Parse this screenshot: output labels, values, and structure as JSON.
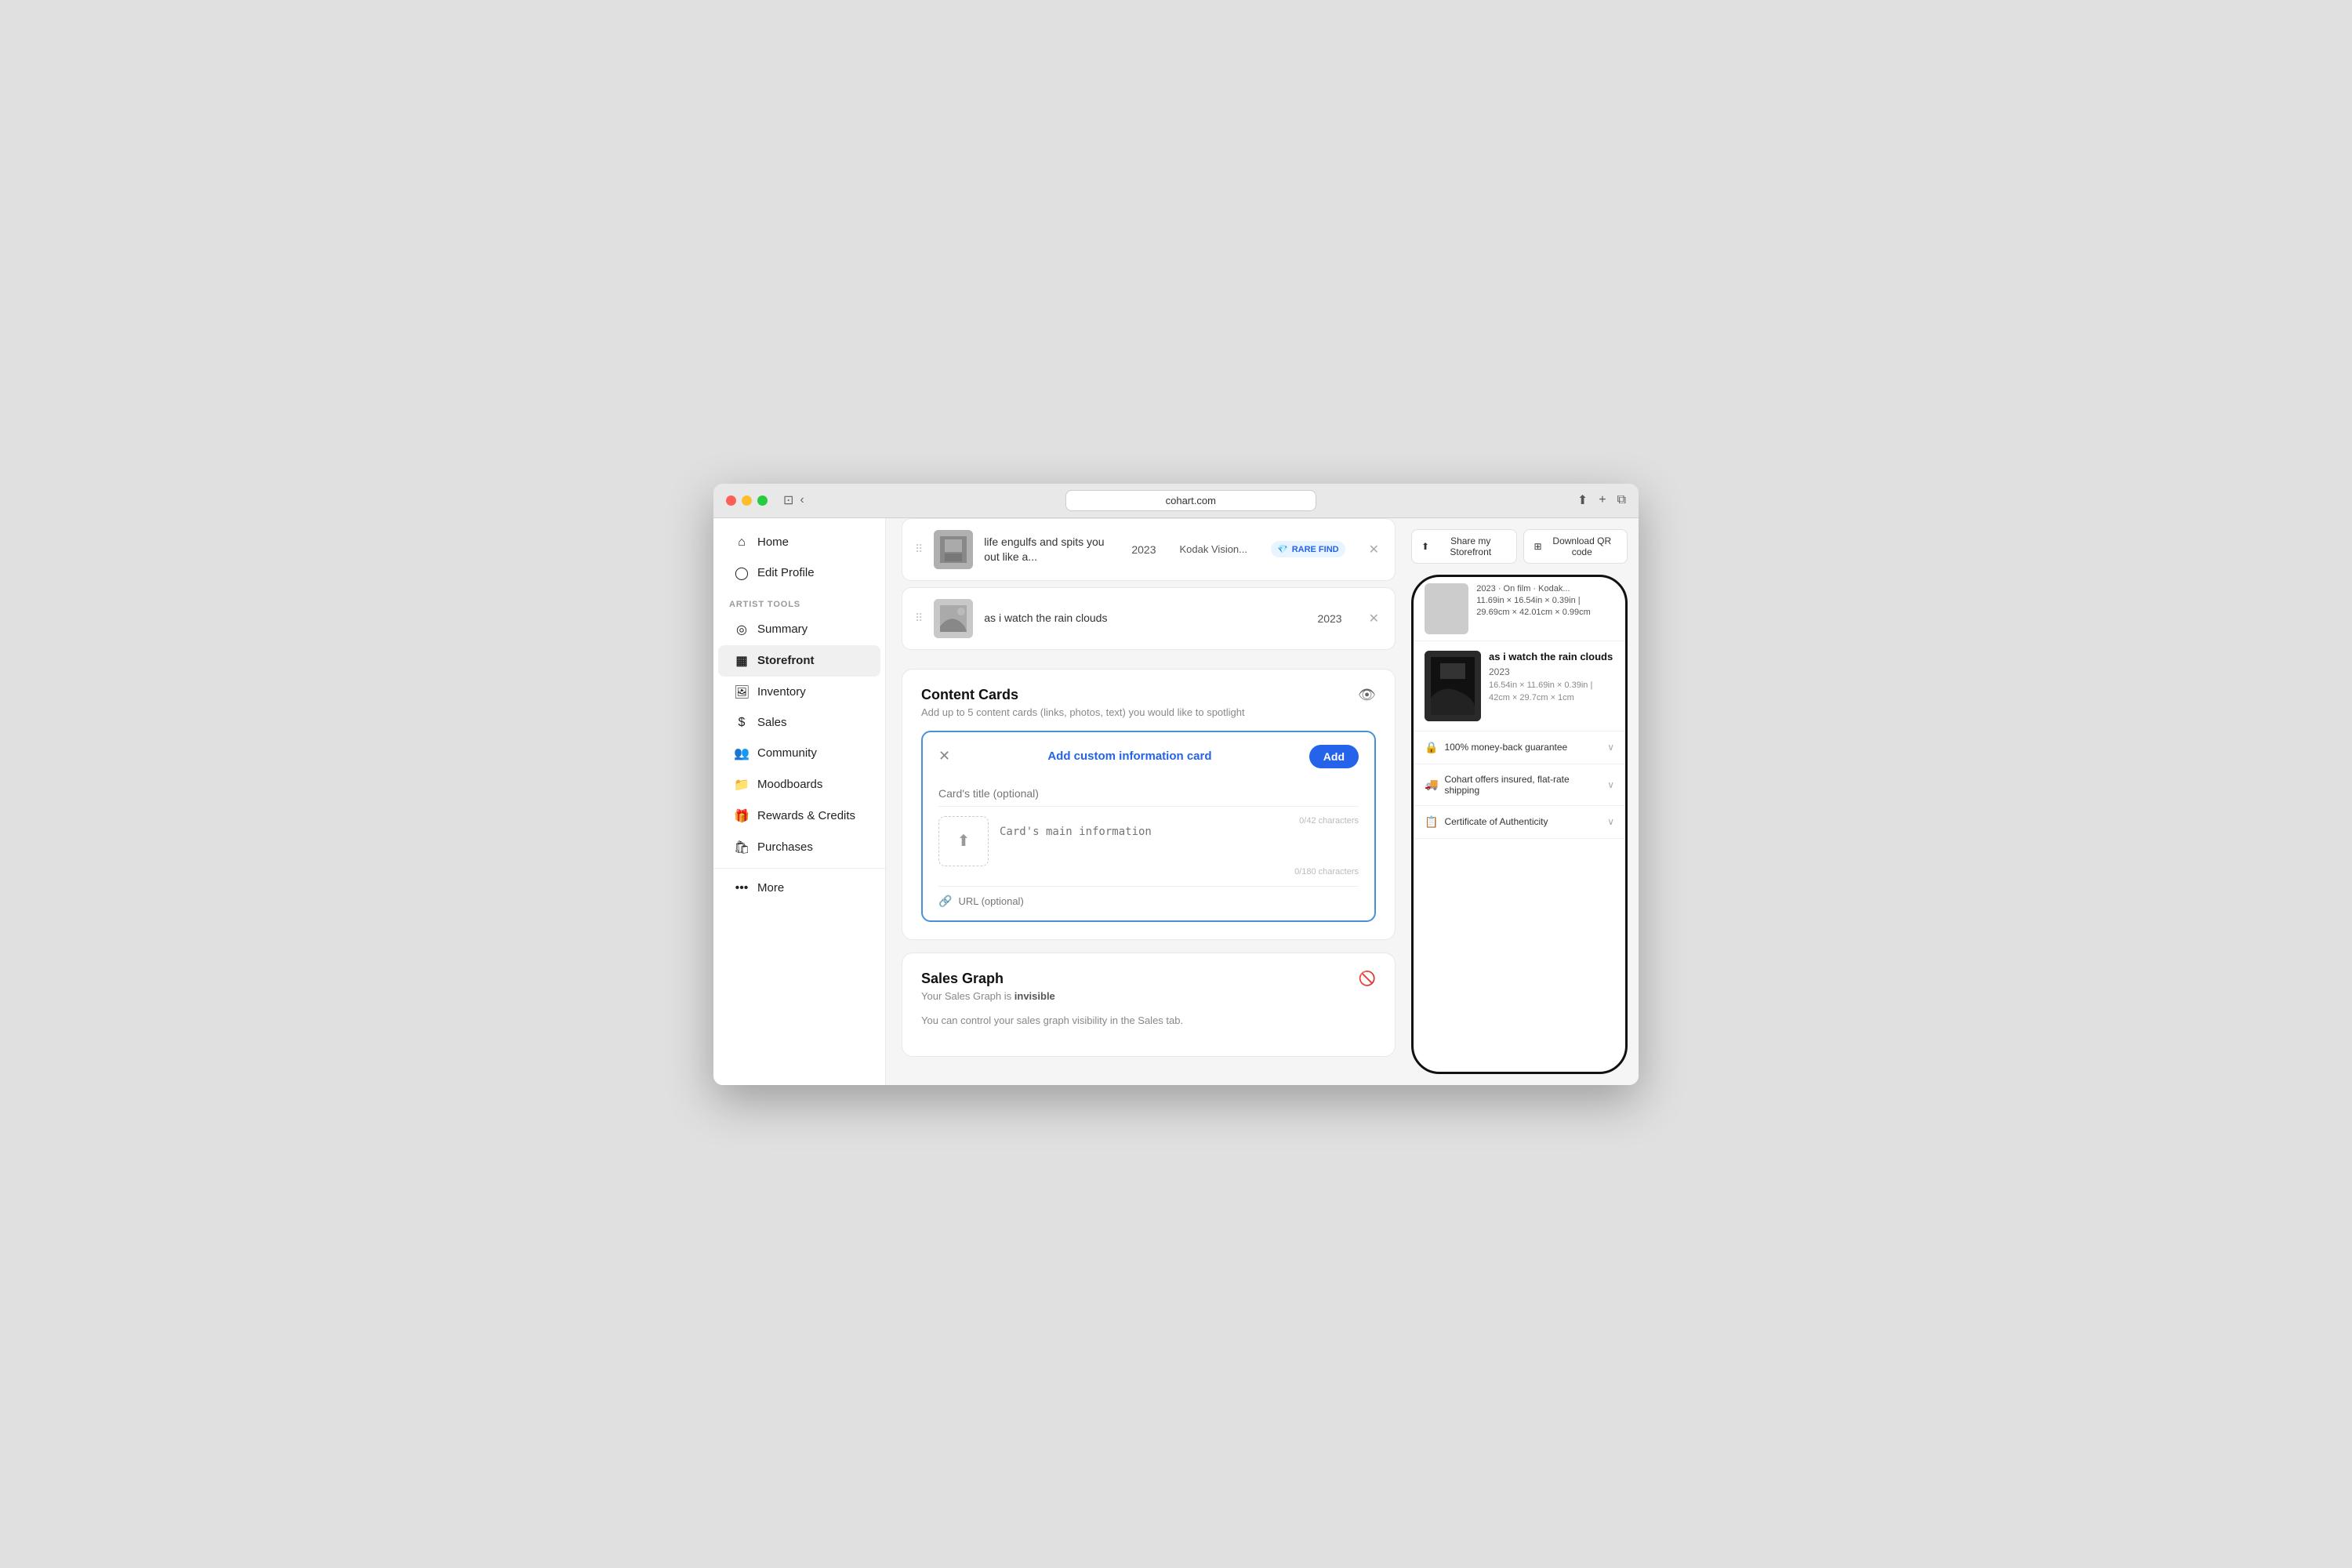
{
  "browser": {
    "url": "cohart.com",
    "url_icon": "🔒"
  },
  "sidebar": {
    "home_label": "Home",
    "edit_profile_label": "Edit Profile",
    "artist_tools_section": "ARTIST TOOLS",
    "items": [
      {
        "id": "summary",
        "label": "Summary",
        "icon": "○"
      },
      {
        "id": "storefront",
        "label": "Storefront",
        "icon": "▦"
      },
      {
        "id": "inventory",
        "label": "Inventory",
        "icon": "🖼"
      },
      {
        "id": "sales",
        "label": "Sales",
        "icon": "💲"
      },
      {
        "id": "community",
        "label": "Community",
        "icon": "👥"
      },
      {
        "id": "moodboards",
        "label": "Moodboards",
        "icon": "📁"
      },
      {
        "id": "rewards-credits",
        "label": "Rewards & Credits",
        "icon": "🎁"
      },
      {
        "id": "purchases",
        "label": "Purchases",
        "icon": "🛍"
      }
    ],
    "more_label": "More"
  },
  "artwork_items": [
    {
      "id": "item1",
      "title": "life engulfs and spits you out like a...",
      "year": "2023",
      "medium": "Kodak Vision...",
      "badge": "RARE FIND",
      "has_badge": true
    },
    {
      "id": "item2",
      "title": "as i watch the rain clouds",
      "year": "2023",
      "medium": "",
      "has_badge": false
    }
  ],
  "content_cards": {
    "title": "Content Cards",
    "subtitle": "Add up to 5 content cards (links, photos, text) you would like to spotlight",
    "custom_card": {
      "header_title": "Add custom information card",
      "add_btn": "Add",
      "title_placeholder": "Card's title (optional)",
      "main_info_placeholder": "Card's main information",
      "title_char_count": "0/42 characters",
      "main_char_count": "0/180 characters",
      "url_placeholder": "URL (optional)"
    }
  },
  "sales_graph": {
    "title": "Sales Graph",
    "subtitle_prefix": "Your Sales Graph is ",
    "subtitle_status": "invisible",
    "subtitle_suffix": "",
    "note": "You can control your sales graph visibility in the Sales tab."
  },
  "right_panel": {
    "share_btn": "Share my Storefront",
    "qr_btn": "Download QR code",
    "phone_items": [
      {
        "title": "2023 · On film · Kodak...",
        "dims": "11.69in × 16.54in × 0.39in | 29.69cm × 42.01cm × 0.99cm"
      },
      {
        "title": "as i watch the rain clouds",
        "year": "2023",
        "dims": "16.54in × 11.69in × 0.39in | 42cm × 29.7cm × 1cm"
      }
    ],
    "features": [
      {
        "id": "money-back",
        "icon": "🔒",
        "text": "100% money-back guarantee"
      },
      {
        "id": "shipping",
        "icon": "🚚",
        "text": "Cohart offers insured, flat-rate shipping"
      },
      {
        "id": "certificate",
        "icon": "📋",
        "text": "Certificate of Authenticity"
      }
    ]
  }
}
